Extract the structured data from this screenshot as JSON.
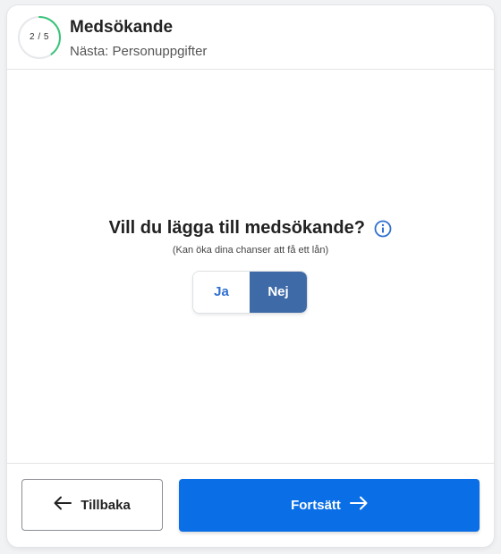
{
  "header": {
    "step_indicator": "2 / 5",
    "step_current": 2,
    "step_total": 5,
    "title": "Medsökande",
    "subtitle": "Nästa: Personuppgifter"
  },
  "question": {
    "text": "Vill du lägga till medsökande?",
    "hint": "(Kan öka dina chanser att få ett lån)",
    "info_icon": "info-icon"
  },
  "toggle": {
    "yes_label": "Ja",
    "no_label": "Nej",
    "selected": "Nej"
  },
  "footer": {
    "back_label": "Tillbaka",
    "next_label": "Fortsätt"
  },
  "colors": {
    "primary": "#0a6ee6",
    "selected_toggle": "#3f6aa8",
    "toggle_text": "#2f6fd0",
    "progress_arc": "#3cc47c",
    "progress_track": "#e6e8eb"
  }
}
